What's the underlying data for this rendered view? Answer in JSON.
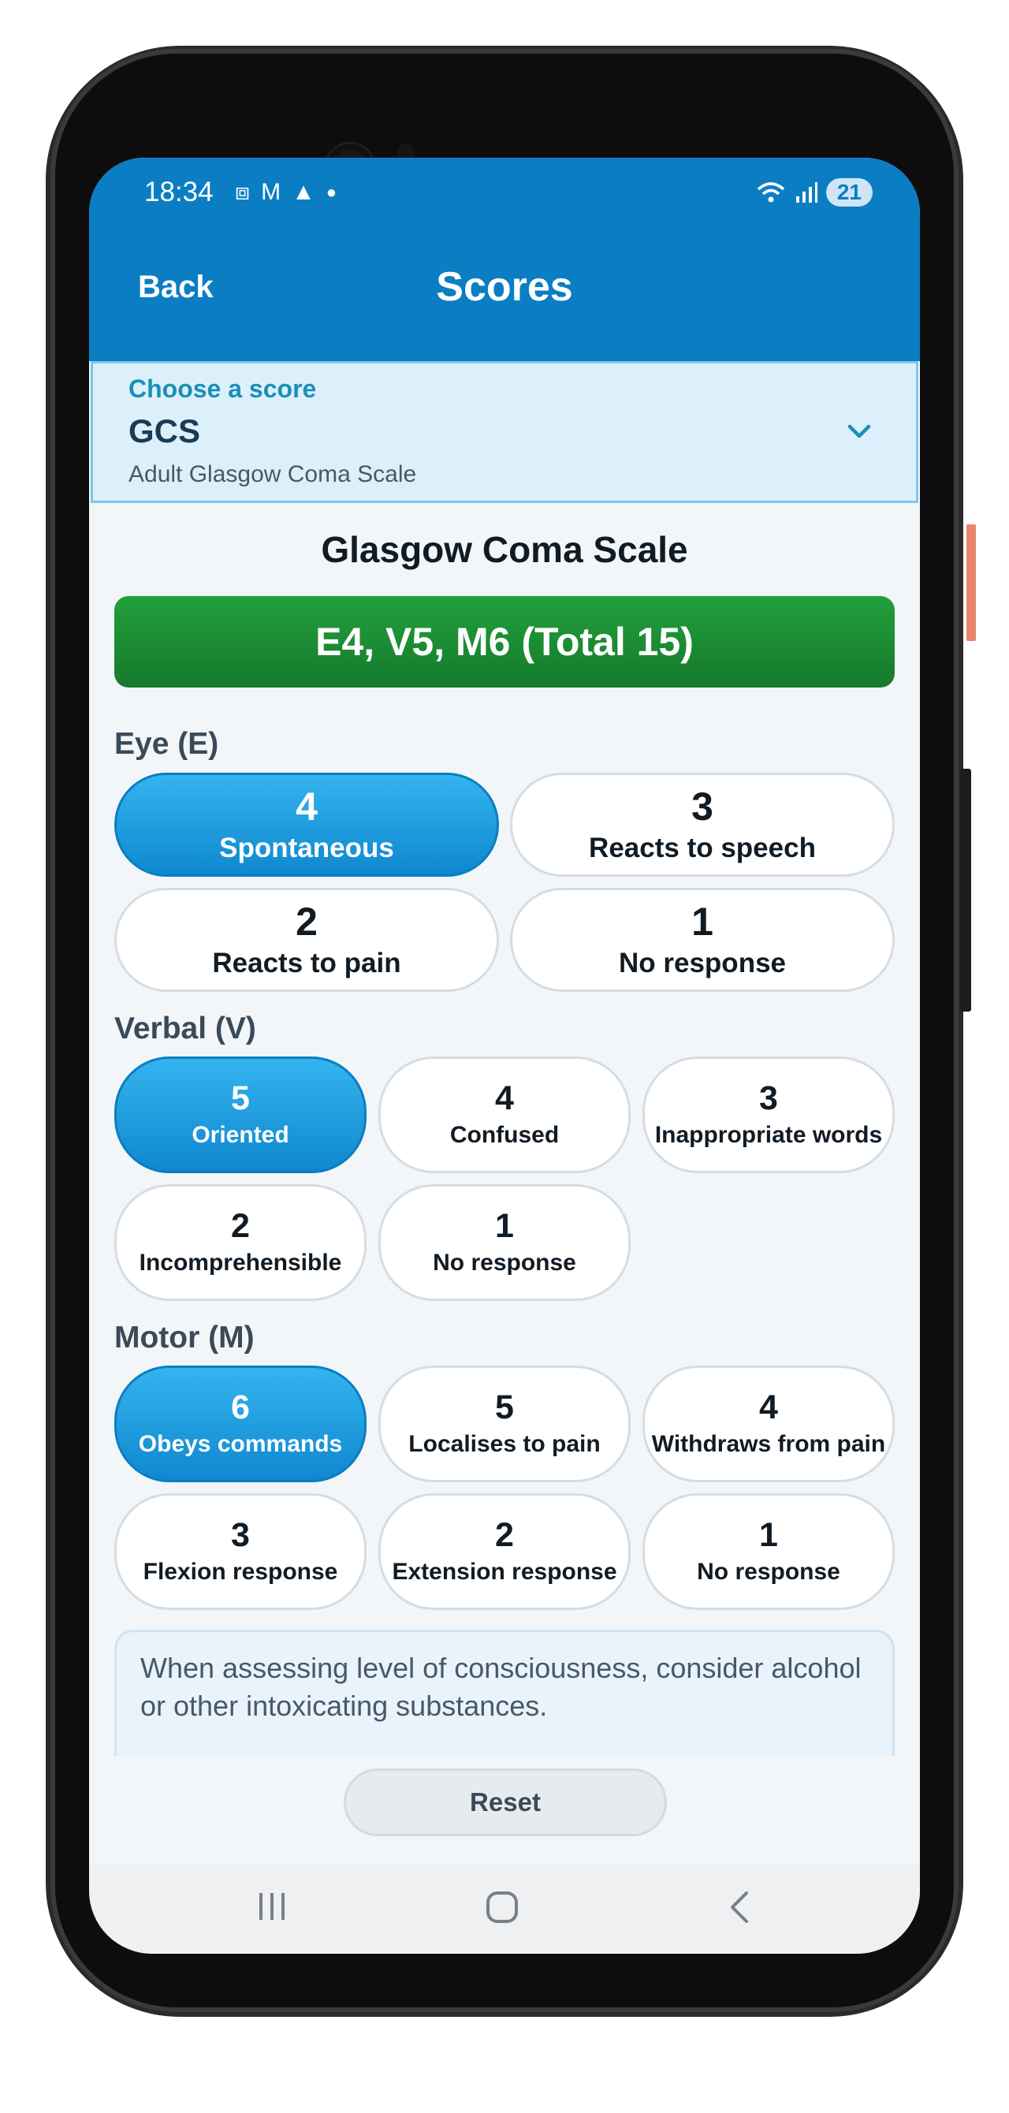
{
  "status_bar": {
    "time": "18:34",
    "left_icons": [
      "screenshot-icon",
      "gmail-icon",
      "shopping-bag-icon",
      "dot-icon"
    ],
    "right_icons": [
      "wifi-icon",
      "signal-icon"
    ],
    "battery": "21"
  },
  "header": {
    "back_label": "Back",
    "title": "Scores"
  },
  "score_picker": {
    "label": "Choose a score",
    "value": "GCS",
    "description": "Adult Glasgow Coma Scale"
  },
  "scale_title": "Glasgow Coma Scale",
  "result": "E4, V5, M6  (Total 15)",
  "sections": {
    "eye": {
      "label": "Eye (E)",
      "options": [
        {
          "score": "4",
          "label": "Spontaneous",
          "selected": true
        },
        {
          "score": "3",
          "label": "Reacts to speech",
          "selected": false
        },
        {
          "score": "2",
          "label": "Reacts to pain",
          "selected": false
        },
        {
          "score": "1",
          "label": "No response",
          "selected": false
        }
      ]
    },
    "verbal": {
      "label": "Verbal (V)",
      "options": [
        {
          "score": "5",
          "label": "Oriented",
          "selected": true
        },
        {
          "score": "4",
          "label": "Confused",
          "selected": false
        },
        {
          "score": "3",
          "label": "Inappropriate words",
          "selected": false
        },
        {
          "score": "2",
          "label": "Incomprehensible",
          "selected": false
        },
        {
          "score": "1",
          "label": "No response",
          "selected": false
        }
      ]
    },
    "motor": {
      "label": "Motor (M)",
      "options": [
        {
          "score": "6",
          "label": "Obeys commands",
          "selected": true
        },
        {
          "score": "5",
          "label": "Localises to pain",
          "selected": false
        },
        {
          "score": "4",
          "label": "Withdraws from pain",
          "selected": false
        },
        {
          "score": "3",
          "label": "Flexion response",
          "selected": false
        },
        {
          "score": "2",
          "label": "Extension response",
          "selected": false
        },
        {
          "score": "1",
          "label": "No response",
          "selected": false
        }
      ]
    }
  },
  "note": "When assessing level of consciousness, consider alcohol or other intoxicating substances.",
  "reset_label": "Reset",
  "colors": {
    "app_bar": "#0b7ec3",
    "selected_option": "#1e9fe0",
    "result_bar": "#1c8c34",
    "picker_bg": "#dcf0fb"
  }
}
